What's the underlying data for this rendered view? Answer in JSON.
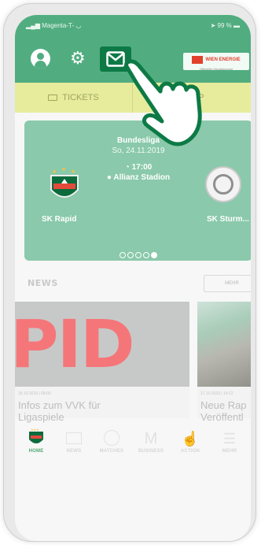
{
  "status_bar": {
    "carrier": "Magenta-T-",
    "time": "",
    "battery": "99 %"
  },
  "header": {
    "user_icon": "user-icon",
    "settings_icon": "gear-icon",
    "mail_icon": "mail-icon",
    "sponsor": {
      "name": "WIEN ENERGIE",
      "tagline": "Offizieller Hauptsponsor"
    }
  },
  "tabs": {
    "tickets": "TICKETS",
    "shop": "SHOP"
  },
  "match": {
    "league": "Bundesliga",
    "date": "So, 24.11.2019",
    "time": "17:00",
    "venue": "Allianz Stadion",
    "home_team": "SK Rapid",
    "away_team": "SK Sturm...",
    "dots_total": 5,
    "dots_active": 5
  },
  "news": {
    "title": "NEWS",
    "more": "MEHR",
    "items": [
      {
        "meta": "18.10.2019 | 08:00",
        "title_line1": "Infos zum VVK für",
        "title_line2": "Ligaspiele",
        "image_text": "PID"
      },
      {
        "meta": "17.10.2019 | 14:12",
        "title_line1": "Neue Rap",
        "title_line2": "Veröffentl"
      }
    ]
  },
  "bottom_nav": [
    "HOME",
    "NEWS",
    "MATCHES",
    "BUSINESS",
    "ACTION",
    "MEHR"
  ],
  "colors": {
    "header": "#51ad80",
    "tabbar": "#e6ec9c",
    "match_card": "#8ac9ab",
    "mail_highlight": "#0d7a45",
    "accent_red": "#f57679"
  }
}
